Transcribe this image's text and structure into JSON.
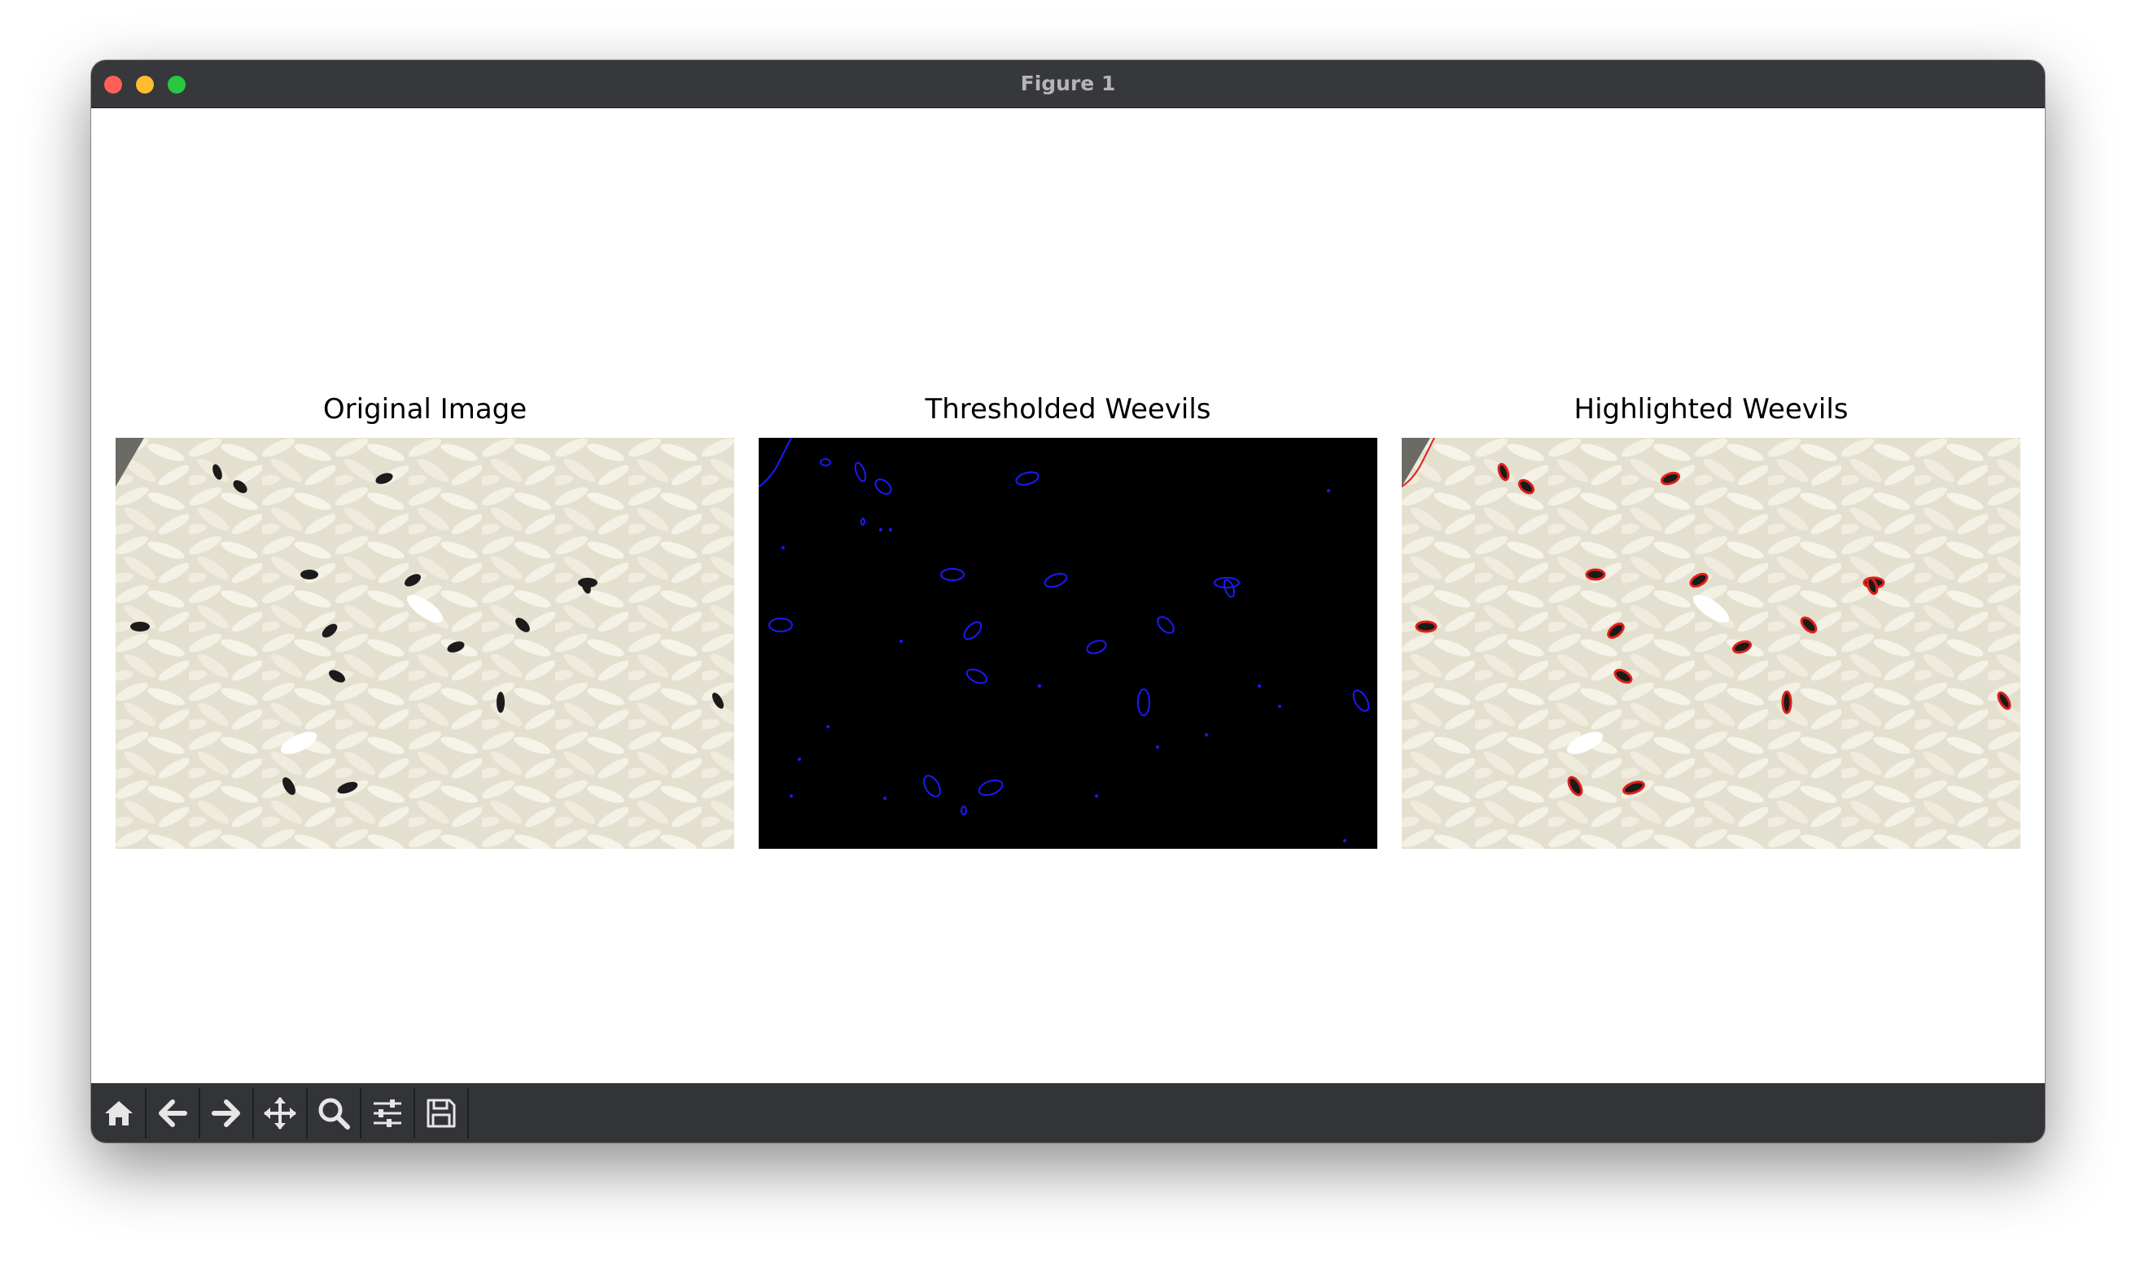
{
  "window": {
    "title": "Figure 1"
  },
  "figure": {
    "panels": [
      {
        "title": "Original Image"
      },
      {
        "title": "Thresholded Weevils"
      },
      {
        "title": "Highlighted Weevils"
      }
    ]
  },
  "toolbar": {
    "buttons": [
      {
        "name": "home",
        "icon": "home-icon"
      },
      {
        "name": "back",
        "icon": "arrow-left-icon"
      },
      {
        "name": "forward",
        "icon": "arrow-right-icon"
      },
      {
        "name": "pan",
        "icon": "move-icon"
      },
      {
        "name": "zoom",
        "icon": "magnifier-icon"
      },
      {
        "name": "configure-subplots",
        "icon": "sliders-icon"
      },
      {
        "name": "save",
        "icon": "floppy-disk-icon"
      }
    ]
  },
  "colors": {
    "titlebar": "#36383b",
    "toolbar": "#323437",
    "contour_blue": "#1a1aff",
    "contour_red": "#e0201a",
    "rice": "#ece8d8"
  }
}
